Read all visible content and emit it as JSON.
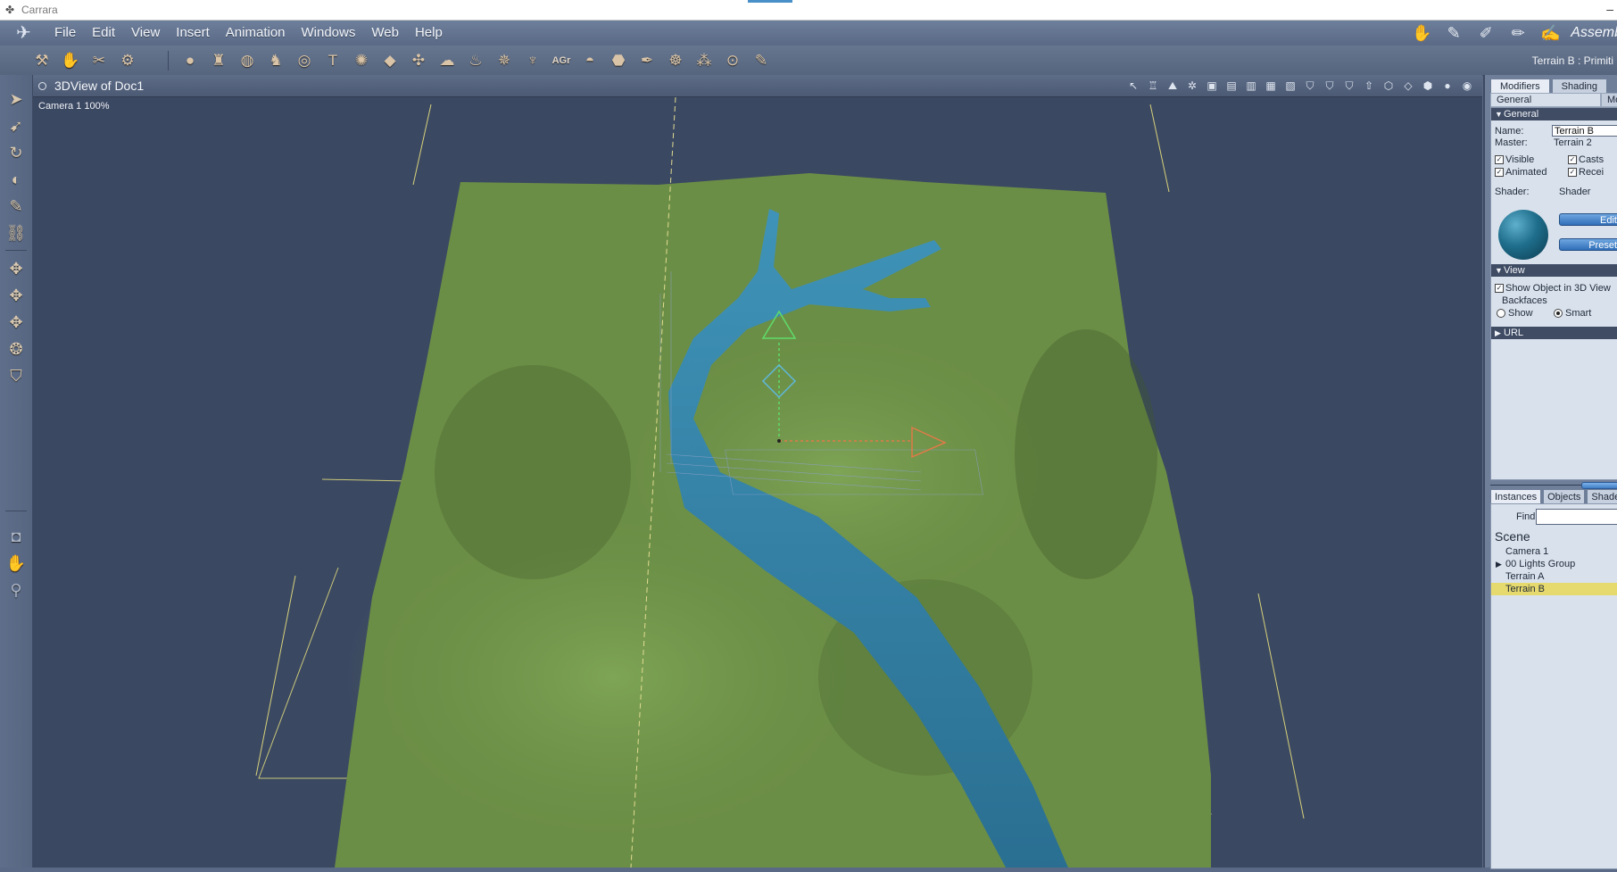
{
  "window": {
    "title": "Carrara",
    "minimize": "–"
  },
  "menu": {
    "logo": "✈",
    "items": [
      "File",
      "Edit",
      "View",
      "Insert",
      "Animation",
      "Windows",
      "Web",
      "Help"
    ]
  },
  "rooms": {
    "icons": [
      "assemble-room-icon",
      "model-room-icon",
      "storyboard-room-icon",
      "texture-room-icon",
      "render-room-icon"
    ],
    "glyphs": [
      "✋",
      "✎",
      "✐",
      "✏",
      "✍"
    ],
    "label": "Assemb"
  },
  "toolbar": {
    "document_info": "Terrain B : Primiti",
    "agt_label": "AGr"
  },
  "viewport": {
    "title": "3DView of Doc1",
    "camera_label": "Camera 1 100%"
  },
  "properties": {
    "tabs": [
      "Modifiers",
      "Shading"
    ],
    "subtabs": [
      "General",
      "Mo"
    ],
    "general_header": "General",
    "name_label": "Name:",
    "name_value": "Terrain B",
    "master_label": "Master:",
    "master_value": "Terrain 2",
    "visible": "Visible",
    "casts": "Casts",
    "animated": "Animated",
    "receive": "Recei",
    "shader_label": "Shader:",
    "shader_value": "Shader",
    "edit_button": "Edit",
    "preset_button": "Preset",
    "view_header": "View",
    "show_in_3d": "Show Object in 3D View",
    "backfaces": "Backfaces",
    "show_option": "Show",
    "smart_option": "Smart",
    "url_header": "URL"
  },
  "scene": {
    "tabs": [
      "Instances",
      "Objects",
      "Shade"
    ],
    "find_label": "Find:",
    "find_value": "",
    "title": "Scene",
    "items": [
      "Camera 1",
      "00 Lights Group",
      "Terrain A",
      "Terrain B"
    ],
    "selected": "Terrain B"
  },
  "colors": {
    "terrain": "#6b8e46",
    "water": "#2f7fa6",
    "viewport_bg": "#3b4862",
    "selection": "#e6da6e"
  }
}
